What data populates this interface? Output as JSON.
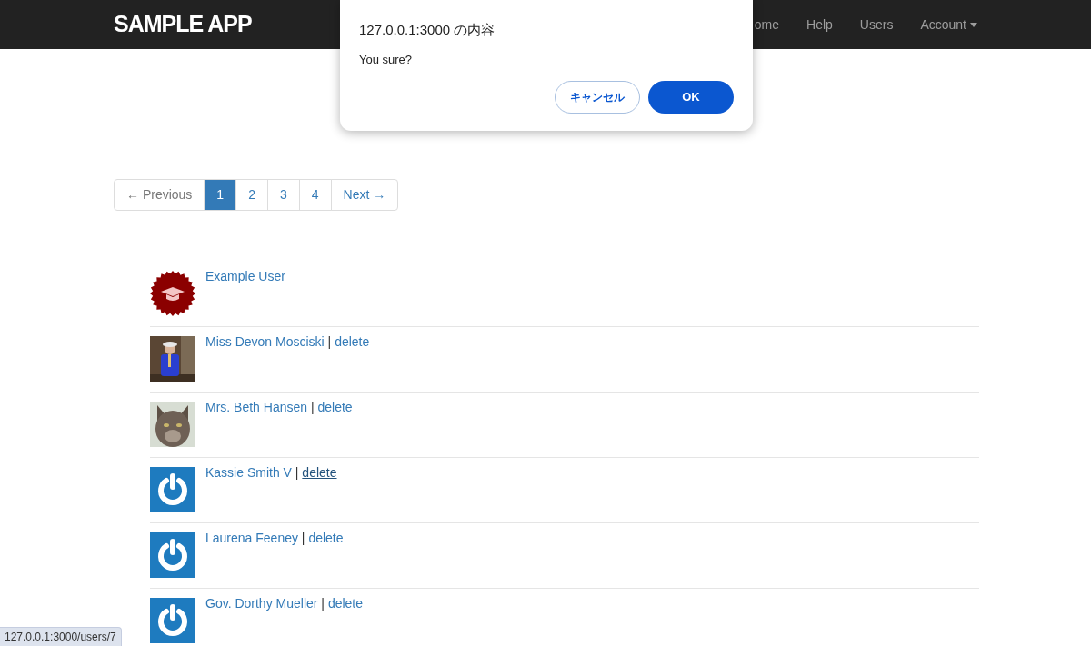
{
  "navbar": {
    "brand": "SAMPLE APP",
    "links": [
      {
        "label": "ome",
        "dropdown": false
      },
      {
        "label": "Help",
        "dropdown": false
      },
      {
        "label": "Users",
        "dropdown": false
      },
      {
        "label": "Account",
        "dropdown": true
      }
    ]
  },
  "dialog": {
    "title": "127.0.0.1:3000 の内容",
    "message": "You sure?",
    "buttons": [
      {
        "label": "キャンセル",
        "kind": "secondary"
      },
      {
        "label": "OK",
        "kind": "primary"
      }
    ]
  },
  "pagination": [
    {
      "label": "← Previous",
      "selected": false,
      "disabled": true
    },
    {
      "label": "1",
      "selected": true,
      "disabled": false
    },
    {
      "label": "2",
      "selected": false,
      "disabled": false
    },
    {
      "label": "3",
      "selected": false,
      "disabled": false
    },
    {
      "label": "4",
      "selected": false,
      "disabled": false
    },
    {
      "label": "Next →",
      "selected": false,
      "disabled": false
    }
  ],
  "users": [
    {
      "name": "Example User",
      "kind": "badge"
    },
    {
      "name": "Miss Devon Mosciski",
      "kind": "person",
      "separator": "|",
      "delete": "delete",
      "hovered": false
    },
    {
      "name": "Mrs. Beth Hansen",
      "kind": "cat",
      "separator": "|",
      "delete": "delete",
      "hovered": false
    },
    {
      "name": "Kassie Smith V",
      "kind": "power",
      "separator": "|",
      "delete": "delete",
      "hovered": true
    },
    {
      "name": "Laurena Feeney",
      "kind": "power",
      "separator": "|",
      "delete": "delete",
      "hovered": false
    },
    {
      "name": "Gov. Dorthy Mueller",
      "kind": "power",
      "separator": "|",
      "delete": "delete",
      "hovered": false
    }
  ],
  "status_bar": {
    "url": "127.0.0.1:3000/users/7"
  }
}
